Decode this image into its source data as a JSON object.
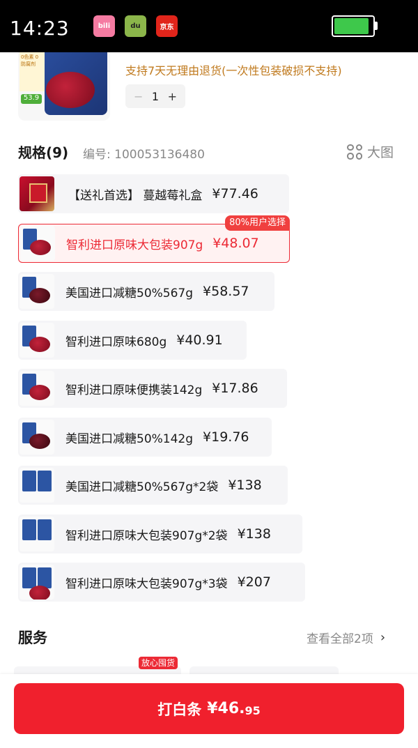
{
  "status_bar": {
    "time": "14:23",
    "apps": [
      "bilibili",
      "得物",
      "京东"
    ],
    "battery_level": 0.9,
    "battery_color": "#3ec84b"
  },
  "product": {
    "return_policy": "支持7天无理由退货(一次性包装破损不支持)",
    "quantity": "1",
    "qty_minus": "−",
    "qty_plus": "+",
    "image_tag": "53.9",
    "image_text": "0色素 0防腐剂"
  },
  "spec": {
    "title": "规格(9)",
    "code": "编号: 100053136480",
    "big_view": "大图",
    "selected_badge": "80%用户选择",
    "options": [
      {
        "label": "【送礼首选】 蔓越莓礼盒",
        "price": "¥77.46",
        "selected": false
      },
      {
        "label": "智利进口原味大包装907g",
        "price": "¥48.07",
        "selected": true
      },
      {
        "label": "美国进口减糖50%567g",
        "price": "¥58.57",
        "selected": false
      },
      {
        "label": "智利进口原味680g",
        "price": "¥40.91",
        "selected": false
      },
      {
        "label": "智利进口原味便携装142g",
        "price": "¥17.86",
        "selected": false
      },
      {
        "label": "美国进口减糖50%142g",
        "price": "¥19.76",
        "selected": false
      },
      {
        "label": "美国进口减糖50%567g*2袋",
        "price": "¥138",
        "selected": false
      },
      {
        "label": "智利进口原味大包装907g*2袋",
        "price": "¥138",
        "selected": false
      },
      {
        "label": "智利进口原味大包装907g*3袋",
        "price": "¥207",
        "selected": false
      }
    ]
  },
  "services": {
    "title": "服务",
    "more": "查看全部2项",
    "badge": "放心囤货"
  },
  "bottom": {
    "pay_label": "打白条",
    "price_int": "¥46.",
    "price_dec": "95"
  },
  "colors": {
    "accent": "#ec2a35",
    "pay_button": "#f0202d",
    "policy_text": "#c07a1e"
  }
}
